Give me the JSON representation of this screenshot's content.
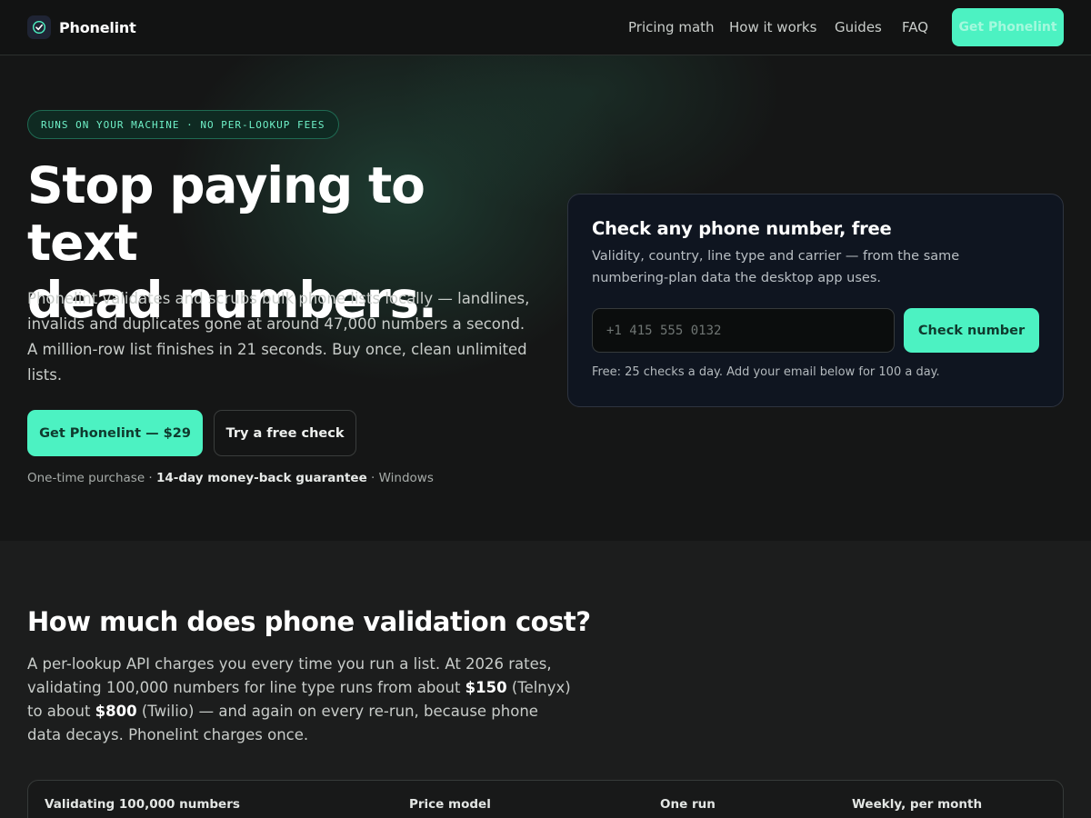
{
  "nav": {
    "brand": "Phonelint",
    "links": [
      "Pricing math",
      "How it works",
      "Guides",
      "FAQ"
    ],
    "cta": "Get Phonelint"
  },
  "hero": {
    "pill": "RUNS ON YOUR MACHINE · NO PER-LOOKUP FEES",
    "title_line1": "Stop paying to text",
    "title_line2": "dead numbers.",
    "lede": "Phonelint validates and scrubs bulk phone lists locally — landlines, invalids and duplicates gone at around 47,000 numbers a second. A million-row list finishes in 21 seconds. Buy once, clean unlimited lists.",
    "primary_cta": "Get Phonelint — $29",
    "secondary_cta": "Try a free check",
    "fine_1": "One-time purchase · ",
    "fine_2": "14-day money-back guarantee",
    "fine_3": " · Windows"
  },
  "checker": {
    "title": "Check any phone number, free",
    "desc": "Validity, country, line type and carrier — from the same numbering-plan data the desktop app uses.",
    "placeholder": "+1 415 555 0132",
    "button": "Check number",
    "note": "Free: 25 checks a day. Add your email below for 100 a day."
  },
  "cost": {
    "heading": "How much does phone validation cost?",
    "p1": "A per-lookup API charges you every time you run a list. At 2026 rates, validating 100,000 numbers for line type runs from about ",
    "p2": "$150",
    "p3": " (Telnyx) to about ",
    "p4": "$800",
    "p5": " (Twilio) — and again on every re-run, because phone data decays. Phonelint charges once.",
    "columns": [
      "Validating 100,000 numbers",
      "Price model",
      "One run",
      "Weekly, per month"
    ]
  },
  "colors": {
    "accent": "#4cf2c2",
    "background": "#171818",
    "card": "#0f1520"
  }
}
